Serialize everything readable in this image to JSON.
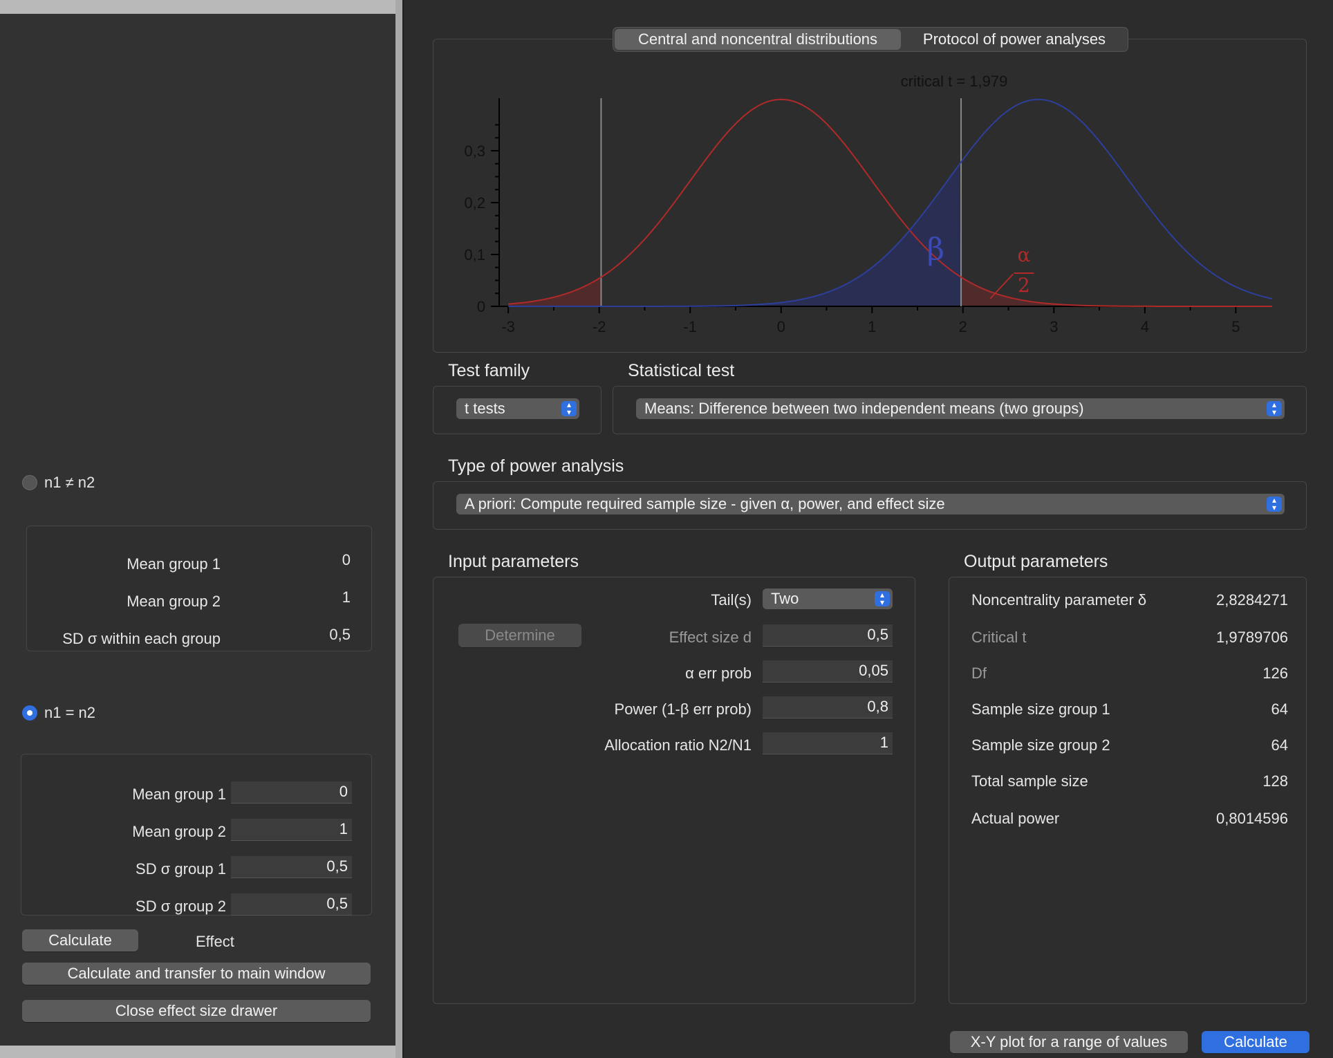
{
  "drawer": {
    "unequal_label": "n1 ≠ n2",
    "unequal_rows": [
      {
        "label": "Mean group 1",
        "value": "0"
      },
      {
        "label": "Mean group 2",
        "value": "1"
      },
      {
        "label": "SD σ within each group",
        "value": "0,5"
      }
    ],
    "equal_label": "n1 = n2",
    "equal_rows": [
      {
        "label": "Mean group 1",
        "value": "0"
      },
      {
        "label": "Mean group 2",
        "value": "1"
      },
      {
        "label": "SD σ group 1",
        "value": "0,5"
      },
      {
        "label": "SD σ group 2",
        "value": "0,5"
      }
    ],
    "calculate_label": "Calculate",
    "effect_label": "Effect",
    "transfer_label": "Calculate and transfer to main window",
    "close_label": "Close effect size drawer"
  },
  "tabs": [
    "Central and noncentral distributions",
    "Protocol of power analyses"
  ],
  "chart_data": {
    "type": "line",
    "critical_label": "critical t = 1,979",
    "critical_t": 1.979,
    "x_ticks": [
      "-3",
      "-2",
      "-1",
      "0",
      "1",
      "2",
      "3",
      "4",
      "5"
    ],
    "y_ticks": [
      "0",
      "0,1",
      "0,2",
      "0,3"
    ],
    "xlim": [
      -3.1,
      5.4
    ],
    "ylim": [
      0,
      0.4
    ],
    "series": [
      {
        "color": "#b02a2a",
        "df": 126,
        "noncentrality": 0
      },
      {
        "color": "#2d3f9c",
        "df": 126,
        "noncentrality": 2.8284271
      }
    ],
    "beta_label": "β",
    "alpha_label": "α",
    "alpha_den": "2"
  },
  "test_family": {
    "title": "Test family",
    "value": "t tests"
  },
  "statistical_test": {
    "title": "Statistical test",
    "value": "Means: Difference between two independent means (two groups)"
  },
  "power_analysis": {
    "title": "Type of power analysis",
    "value": "A priori: Compute required sample size - given α, power, and effect size"
  },
  "input": {
    "title": "Input parameters",
    "tails_label": "Tail(s)",
    "tails_value": "Two",
    "determine_label": "Determine",
    "rows": [
      {
        "label": "Effect size d",
        "value": "0,5"
      },
      {
        "label": "α err prob",
        "value": "0,05"
      },
      {
        "label": "Power (1-β err prob)",
        "value": "0,8"
      },
      {
        "label": "Allocation ratio N2/N1",
        "value": "1"
      }
    ]
  },
  "output": {
    "title": "Output parameters",
    "rows": [
      {
        "label": "Noncentrality parameter δ",
        "value": "2,8284271"
      },
      {
        "label": "Critical t",
        "value": "1,9789706"
      },
      {
        "label": "Df",
        "value": "126"
      },
      {
        "label": "Sample size group 1",
        "value": "64"
      },
      {
        "label": "Sample size group 2",
        "value": "64"
      },
      {
        "label": "Total sample size",
        "value": "128"
      },
      {
        "label": "Actual power",
        "value": "0,8014596"
      }
    ]
  },
  "footer": {
    "xy_plot_label": "X-Y plot for a range of values",
    "calculate_label": "Calculate"
  },
  "colors": {
    "accent": "#2f6fe0",
    "central": "#b02a2a",
    "noncentral": "#2d3f9c"
  }
}
